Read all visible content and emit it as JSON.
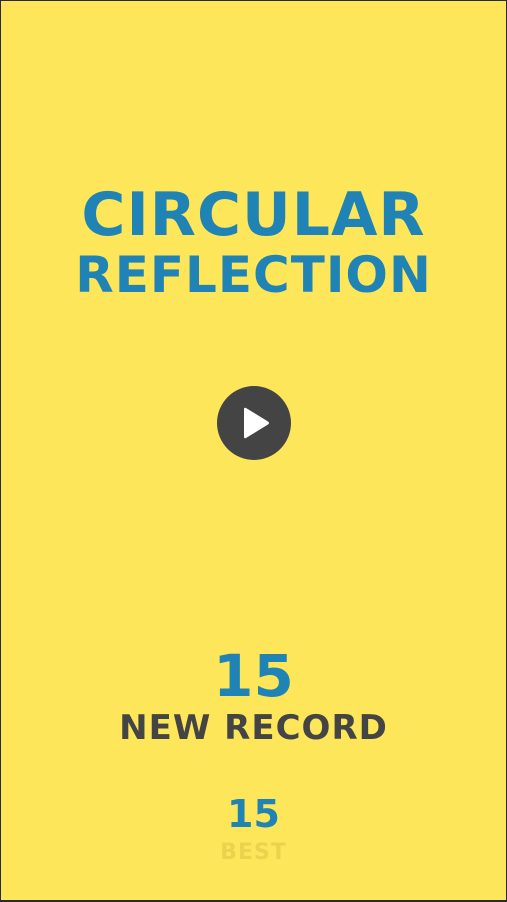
{
  "title": {
    "line1": "CIRCULAR",
    "line2": "REFLECTION"
  },
  "play_button": {
    "icon": "play-icon"
  },
  "result": {
    "score": "15",
    "status": "NEW RECORD"
  },
  "best": {
    "score": "15",
    "label": "BEST"
  },
  "colors": {
    "background": "#fde65a",
    "primary_blue": "#1f83b5",
    "dark_gray": "#444444",
    "muted_yellow": "#ecd34d"
  }
}
